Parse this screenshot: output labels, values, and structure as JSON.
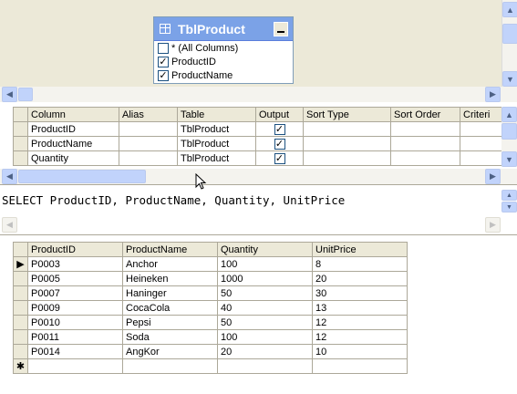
{
  "diagram": {
    "table_title": "TblProduct",
    "columns": [
      {
        "label": "* (All Columns)",
        "checked": false
      },
      {
        "label": "ProductID",
        "checked": true
      },
      {
        "label": "ProductName",
        "checked": true
      }
    ]
  },
  "criteria_grid": {
    "headers": [
      "Column",
      "Alias",
      "Table",
      "Output",
      "Sort Type",
      "Sort Order",
      "Criteri"
    ],
    "rows": [
      {
        "column": "ProductID",
        "alias": "",
        "table": "TblProduct",
        "output": true
      },
      {
        "column": "ProductName",
        "alias": "",
        "table": "TblProduct",
        "output": true
      },
      {
        "column": "Quantity",
        "alias": "",
        "table": "TblProduct",
        "output": true
      }
    ]
  },
  "sql": {
    "text": "SELECT ProductID, ProductName, Quantity, UnitPrice"
  },
  "results": {
    "headers": [
      "ProductID",
      "ProductName",
      "Quantity",
      "UnitPrice"
    ],
    "rows": [
      [
        "P0003",
        "Anchor",
        "100",
        "8"
      ],
      [
        "P0005",
        "Heineken",
        "1000",
        "20"
      ],
      [
        "P0007",
        "Haninger",
        "50",
        "30"
      ],
      [
        "P0009",
        "CocaCola",
        "40",
        "13"
      ],
      [
        "P0010",
        "Pepsi",
        "50",
        "12"
      ],
      [
        "P0011",
        "Soda",
        "100",
        "12"
      ],
      [
        "P0014",
        "AngKor",
        "20",
        "10"
      ]
    ],
    "current_row_marker": "▶",
    "new_row_marker": "✱"
  },
  "colors": {
    "titlebar": "#7ba2e7",
    "pane_background": "#ece9d8",
    "scroll_button": "#c1d3fb"
  }
}
